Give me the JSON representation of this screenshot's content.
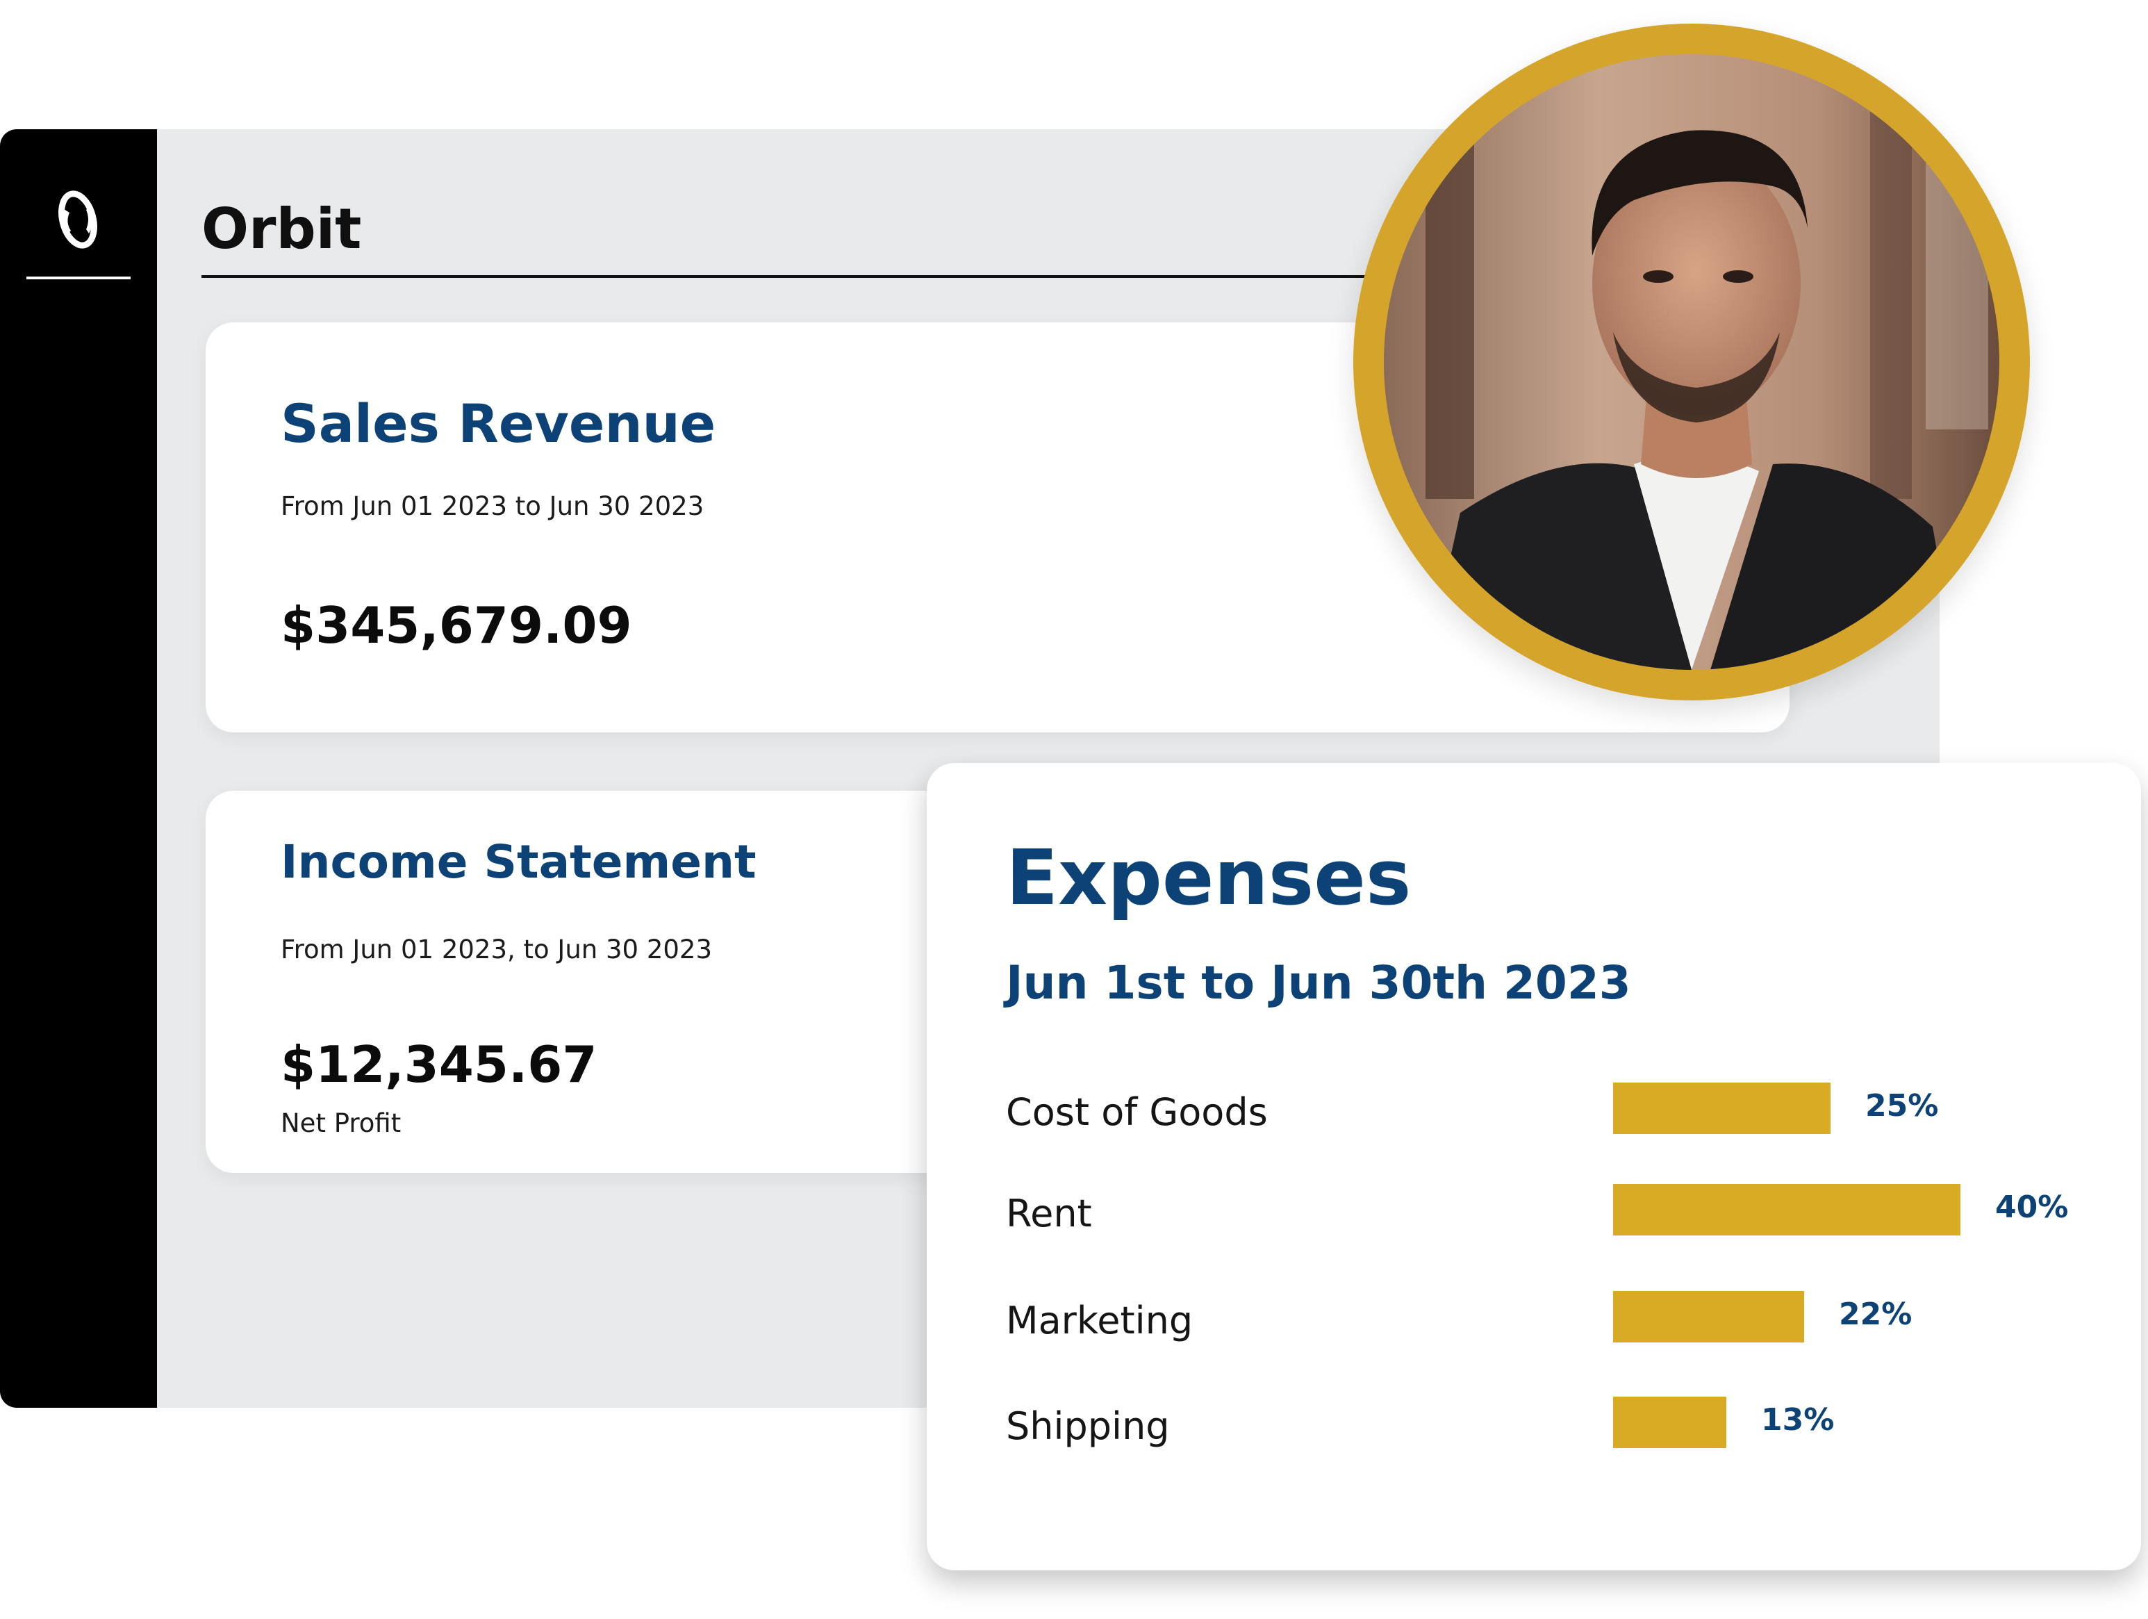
{
  "app": {
    "title": "Orbit"
  },
  "sales_revenue": {
    "title": "Sales Revenue",
    "range": "From Jun 01 2023 to Jun 30 2023",
    "amount": "$345,679.09"
  },
  "income_statement": {
    "title": "Income Statement",
    "range": "From Jun 01 2023, to Jun 30 2023",
    "amount": "$12,345.67",
    "caption": "Net Profit"
  },
  "expenses": {
    "title": "Expenses",
    "range": "Jun 1st to Jun 30th 2023",
    "items": [
      {
        "label": "Cost of Goods",
        "percent": 25,
        "percent_label": "25%"
      },
      {
        "label": "Rent",
        "percent": 40,
        "percent_label": "40%"
      },
      {
        "label": "Marketing",
        "percent": 22,
        "percent_label": "22%"
      },
      {
        "label": "Shipping",
        "percent": 13,
        "percent_label": "13%"
      }
    ]
  },
  "colors": {
    "brand_blue": "#0d4277",
    "accent_gold": "#d9aa24",
    "sidebar": "#000000",
    "panel": "#e9eaec"
  },
  "icons": {
    "logo": "orbit-logo-icon"
  }
}
